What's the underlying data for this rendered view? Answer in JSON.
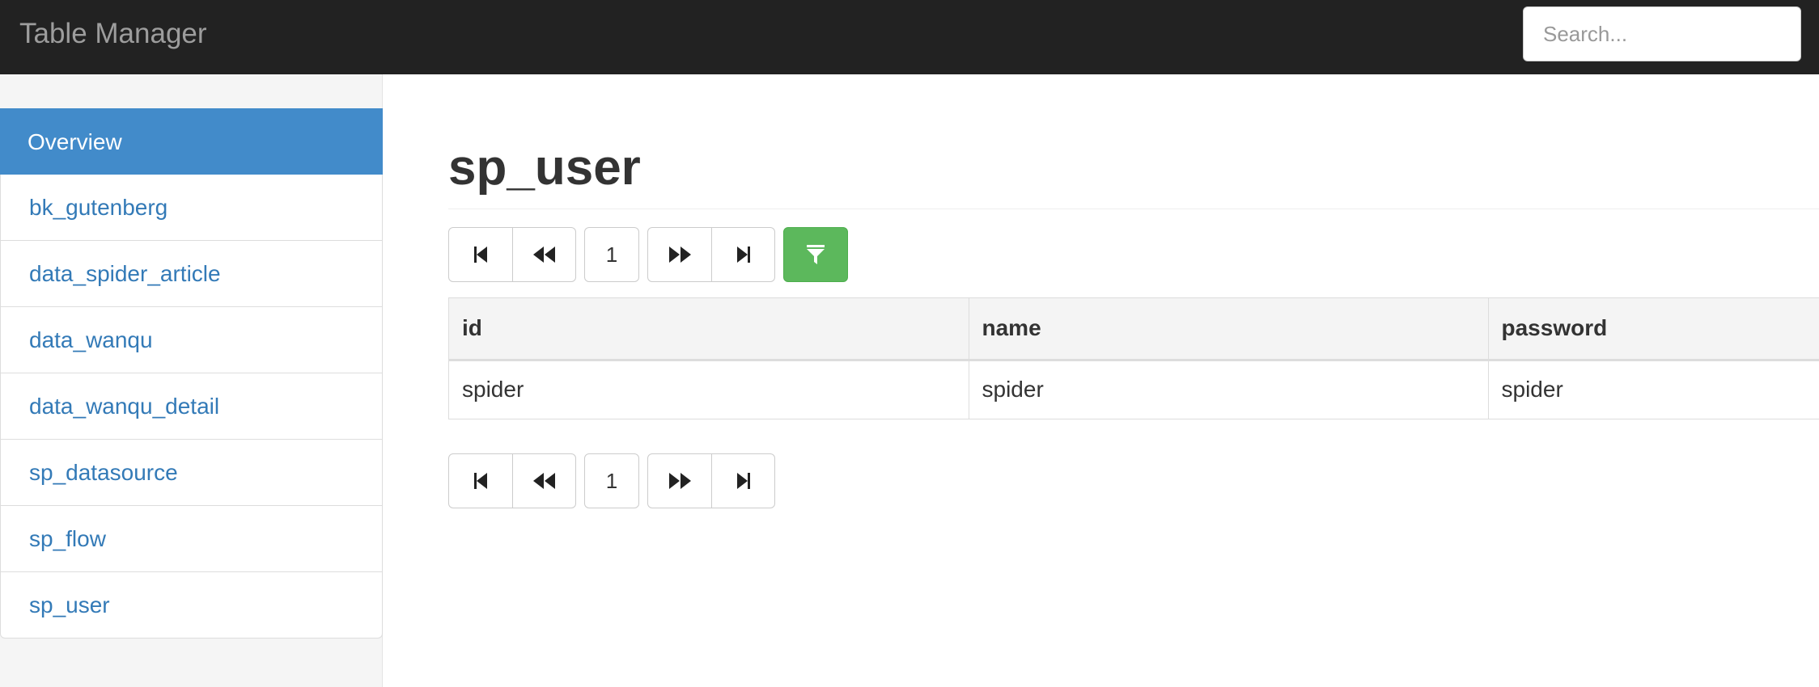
{
  "navbar": {
    "brand": "Table Manager",
    "search_placeholder": "Search..."
  },
  "sidebar": {
    "items": [
      {
        "label": "Overview",
        "active": true
      },
      {
        "label": "bk_gutenberg"
      },
      {
        "label": "data_spider_article"
      },
      {
        "label": "data_wanqu"
      },
      {
        "label": "data_wanqu_detail"
      },
      {
        "label": "sp_datasource"
      },
      {
        "label": "sp_flow"
      },
      {
        "label": "sp_user"
      }
    ]
  },
  "main": {
    "title": "sp_user",
    "pagination": {
      "current_page": "1",
      "first_icon": "step-backward-icon",
      "prev_icon": "backward-icon",
      "next_icon": "forward-icon",
      "last_icon": "step-forward-icon"
    },
    "filter_icon": "filter-icon",
    "filter_color": "#5cb85c",
    "table": {
      "columns": [
        "id",
        "name",
        "password"
      ],
      "rows": [
        [
          "spider",
          "spider",
          "spider"
        ]
      ]
    }
  },
  "colors": {
    "navbar_bg": "#222222",
    "active_item": "#428bca",
    "link": "#337ab7"
  }
}
